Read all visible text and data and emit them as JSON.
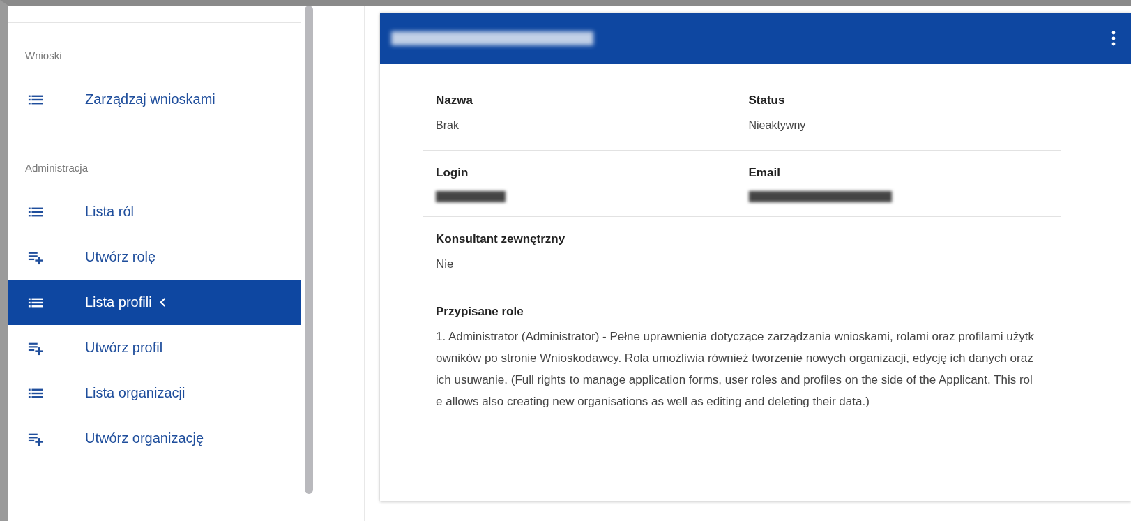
{
  "sidebar": {
    "sections": [
      {
        "label": "Wnioski",
        "items": [
          {
            "label": "Zarządzaj wnioskami",
            "kind": "list",
            "selected": false
          }
        ]
      },
      {
        "label": "Administracja",
        "items": [
          {
            "label": "Lista ról",
            "kind": "list",
            "selected": false
          },
          {
            "label": "Utwórz rolę",
            "kind": "add",
            "selected": false
          },
          {
            "label": "Lista profili",
            "kind": "list",
            "selected": true
          },
          {
            "label": "Utwórz profil",
            "kind": "add",
            "selected": false
          },
          {
            "label": "Lista organizacji",
            "kind": "list",
            "selected": false
          },
          {
            "label": "Utwórz organizację",
            "kind": "add",
            "selected": false
          }
        ]
      }
    ]
  },
  "card": {
    "rows": [
      {
        "fields": [
          {
            "label": "Nazwa",
            "value": "Brak",
            "redacted": false
          },
          {
            "label": "Status",
            "value": "Nieaktywny",
            "redacted": false
          }
        ]
      },
      {
        "fields": [
          {
            "label": "Login",
            "redacted": true
          },
          {
            "label": "Email",
            "redacted": true
          }
        ]
      },
      {
        "fields": [
          {
            "label": "Konsultant zewnętrzny",
            "value": "Nie",
            "redacted": false
          }
        ]
      },
      {
        "fields": [
          {
            "label": "Przypisane role",
            "value": "1. Administrator (Administrator) - Pełne uprawnienia dotyczące zarządzania wnioskami, rolami oraz profilami użytkowników po stronie Wnioskodawcy. Rola umożliwia również tworzenie nowych organizacji, edycję ich danych oraz ich usuwanie. (Full rights to manage application forms, user roles and profiles on the side of the Applicant. This role allows also creating new organisations as well as editing and deleting their data.)",
            "redacted": false
          }
        ]
      }
    ]
  }
}
